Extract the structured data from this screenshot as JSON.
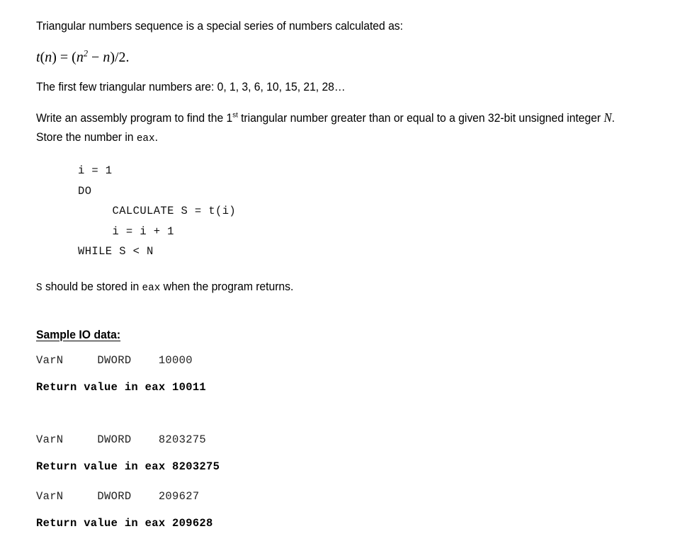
{
  "document": {
    "intro_line": "Triangular numbers sequence is a special series of numbers calculated as:",
    "formula": {
      "lhs_fn": "t",
      "lhs_arg": "n",
      "rhs": "(n² − n)/2.",
      "plain": "t(n) = (n² − n)/2."
    },
    "sequence_line": {
      "prefix": "The first few triangular numbers are: ",
      "values": "0, 1, 3, 6, 10, 15, 21, 28…",
      "full": "The first few triangular numbers are: 0, 1, 3, 6, 10, 15, 21, 28…"
    },
    "task": {
      "part1": "Write an assembly program to find the 1",
      "ordinal_suffix": "st",
      "part2": " triangular number greater than or equal to a given 32-bit unsigned integer ",
      "variable": "N",
      "part3": ". Store the number in ",
      "register": "eax",
      "part4": "."
    },
    "pseudocode": {
      "lines": [
        "i = 1",
        "DO",
        "     CALCULATE S = t(i)",
        "     i = i + 1",
        "WHILE S < N"
      ],
      "text": "i = 1\nDO\n     CALCULATE S = t(i)\n     i = i + 1\nWHILE S < N"
    },
    "return_note": {
      "symbol": "S",
      "part1": " should be stored in ",
      "register": "eax",
      "part2": " when the program returns.",
      "full": "S should be stored in eax when the program returns."
    },
    "sample_io": {
      "heading": "Sample IO data:",
      "cases": [
        {
          "declaration": "VarN     DWORD    10000",
          "var_name": "VarN",
          "type": "DWORD",
          "input_value": "10000",
          "result": "Return value in eax 10011",
          "result_label": "Return value in eax",
          "output_value": "10011"
        },
        {
          "declaration": "VarN     DWORD    8203275",
          "var_name": "VarN",
          "type": "DWORD",
          "input_value": "8203275",
          "result": "Return value in eax 8203275",
          "result_label": "Return value in eax",
          "output_value": "8203275"
        },
        {
          "declaration": "VarN     DWORD    209627",
          "var_name": "VarN",
          "type": "DWORD",
          "input_value": "209627",
          "result": "Return value in eax 209628",
          "result_label": "Return value in eax",
          "output_value": "209628"
        }
      ]
    }
  },
  "colors": {
    "background": "#ffffff",
    "text": "#000000",
    "code_text": "#222222"
  }
}
